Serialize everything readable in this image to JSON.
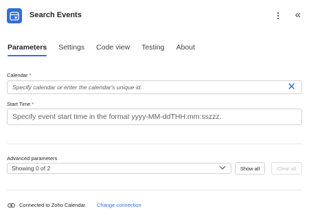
{
  "header": {
    "title": "Search Events",
    "app_icon": "zoho-calendar-icon",
    "brand_color": "#2f6fd6",
    "more_icon": "more-vertical-icon",
    "collapse_label": "«"
  },
  "tabs": [
    {
      "label": "Parameters",
      "active": true
    },
    {
      "label": "Settings",
      "active": false
    },
    {
      "label": "Code view",
      "active": false
    },
    {
      "label": "Testing",
      "active": false
    },
    {
      "label": "About",
      "active": false
    }
  ],
  "fields": {
    "calendar": {
      "label": "Calendar",
      "required_mark": "*",
      "placeholder": "Specify calendar or enter the calendar's unique id.",
      "clear_icon": "close-icon",
      "clear_label": "✕"
    },
    "start_time": {
      "label": "Start Time",
      "required_mark": "*",
      "placeholder": "Specify event start time in the format yyyy-MM-ddTHH:mm:sszzz."
    }
  },
  "advanced": {
    "label": "Advanced parameters",
    "selected": "Showing 0 of 2",
    "show_all": "Show all",
    "clear_all": "Clear all"
  },
  "footer": {
    "connection_text": "Connected to Zoho Calendar.",
    "change_link": "Change connection",
    "link_icon": "link-icon"
  }
}
